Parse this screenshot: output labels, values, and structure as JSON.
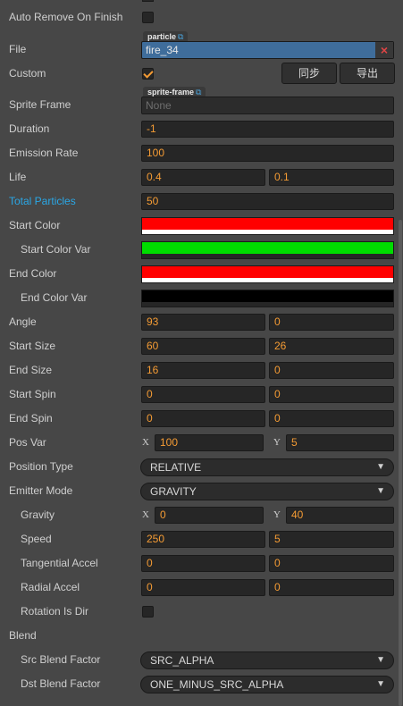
{
  "rows": {
    "auto_remove": {
      "label": "Auto Remove On Finish",
      "checked": false
    },
    "file": {
      "label": "File",
      "tag": "particle",
      "value": "fire_34",
      "clear": "×"
    },
    "custom": {
      "label": "Custom",
      "checked": true,
      "sync_button": "同步",
      "export_button": "导出"
    },
    "sprite_frame": {
      "label": "Sprite Frame",
      "tag": "sprite-frame",
      "value": "None"
    },
    "duration": {
      "label": "Duration",
      "value": "-1"
    },
    "emission_rate": {
      "label": "Emission Rate",
      "value": "100"
    },
    "life": {
      "label": "Life",
      "value": "0.4",
      "var": "0.1"
    },
    "total_particles": {
      "label": "Total Particles",
      "value": "50"
    },
    "start_color": {
      "label": "Start Color",
      "color": "#ff0000"
    },
    "start_color_var": {
      "label": "Start Color Var",
      "color": "#00dd00"
    },
    "end_color": {
      "label": "End Color",
      "color": "#ff0000"
    },
    "end_color_var": {
      "label": "End Color Var",
      "color": "#000000"
    },
    "angle": {
      "label": "Angle",
      "value": "93",
      "var": "0"
    },
    "start_size": {
      "label": "Start Size",
      "value": "60",
      "var": "26"
    },
    "end_size": {
      "label": "End Size",
      "value": "16",
      "var": "0"
    },
    "start_spin": {
      "label": "Start Spin",
      "value": "0",
      "var": "0"
    },
    "end_spin": {
      "label": "End Spin",
      "value": "0",
      "var": "0"
    },
    "pos_var": {
      "label": "Pos Var",
      "x_label": "X",
      "x": "100",
      "y_label": "Y",
      "y": "5"
    },
    "position_type": {
      "label": "Position Type",
      "value": "RELATIVE"
    },
    "emitter_mode": {
      "label": "Emitter Mode",
      "value": "GRAVITY"
    },
    "gravity": {
      "label": "Gravity",
      "x_label": "X",
      "x": "0",
      "y_label": "Y",
      "y": "40"
    },
    "speed": {
      "label": "Speed",
      "value": "250",
      "var": "5"
    },
    "tangential_accel": {
      "label": "Tangential Accel",
      "value": "0",
      "var": "0"
    },
    "radial_accel": {
      "label": "Radial Accel",
      "value": "0",
      "var": "0"
    },
    "rotation_is_dir": {
      "label": "Rotation Is Dir",
      "checked": false
    },
    "blend": {
      "label": "Blend"
    },
    "src_blend_factor": {
      "label": "Src Blend Factor",
      "value": "SRC_ALPHA"
    },
    "dst_blend_factor": {
      "label": "Dst Blend Factor",
      "value": "ONE_MINUS_SRC_ALPHA"
    }
  },
  "icons": {
    "dropdown": "▼",
    "external_link": "⧉"
  },
  "colors": {
    "accent": "#f49b34",
    "highlight_label": "#2aa7e6",
    "panel_bg": "#474747",
    "field_bg": "#262626",
    "asset_selected": "#3f6d9b"
  }
}
